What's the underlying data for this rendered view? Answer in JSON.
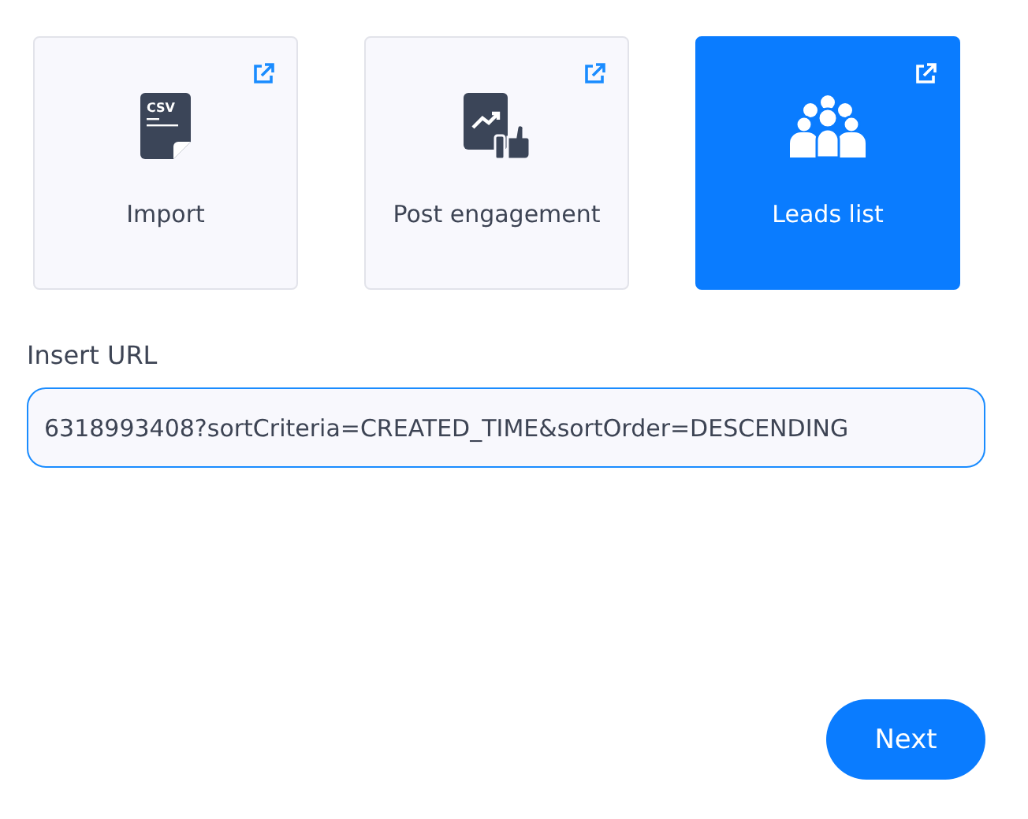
{
  "sources": [
    {
      "kind": "csv",
      "label": "Import",
      "icon_text": "CSV",
      "selected": false
    },
    {
      "kind": "post",
      "label": "Post engagement",
      "selected": false
    },
    {
      "kind": "leads",
      "label": "Leads list",
      "selected": true
    }
  ],
  "url_field": {
    "label": "Insert URL",
    "value": "6318993408?sortCriteria=CREATED_TIME&sortOrder=DESCENDING"
  },
  "next_button": "Next"
}
